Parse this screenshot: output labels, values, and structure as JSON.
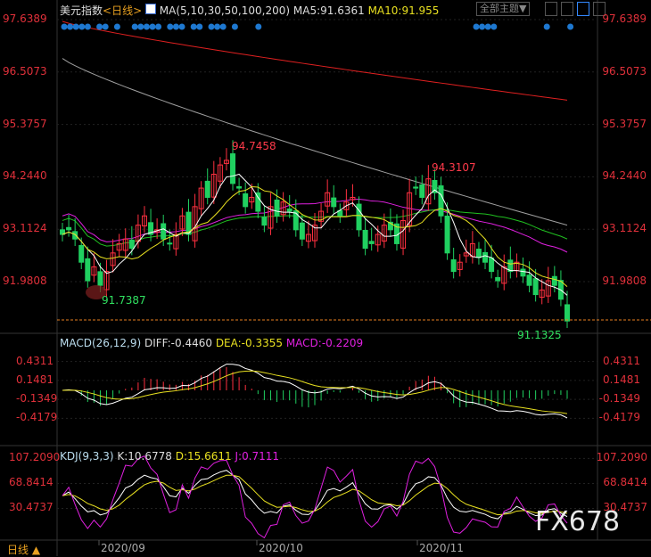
{
  "header": {
    "symbol": "美元指数",
    "period": "<日线>",
    "ma_label": "MA(5,10,30,50,100,200)",
    "ma5": "MA5:91.6361",
    "ma10": "MA10:91.955",
    "theme_button": "全部主题▼"
  },
  "macd": {
    "label": "MACD(26,12,9)",
    "diff": "DIFF:-0.4460",
    "dea": "DEA:-0.3355",
    "macd": "MACD:-0.2209",
    "ticks": [
      "0.4311",
      "0.1481",
      "-0.1349",
      "-0.4179"
    ]
  },
  "kdj": {
    "label": "KDJ(9,3,3)",
    "k": "K:10.6778",
    "d": "D:15.6611",
    "j": "J:0.7111",
    "ticks": [
      "107.2090",
      "68.8414",
      "30.4737"
    ]
  },
  "footer": {
    "period": "日线",
    "dates": [
      "2020/09",
      "2020/10",
      "2020/11"
    ]
  },
  "watermark": "FX678",
  "colors": {
    "up": "#ff3040",
    "down": "#20d060",
    "ma5": "#ffffff",
    "ma10": "#e8e020",
    "ma30": "#e020e0",
    "ma50": "#20c020",
    "ma100": "#a0a0a0",
    "ma200": "#e02020"
  },
  "chart_data": {
    "type": "candlestick",
    "y_ticks": [
      "97.6389",
      "96.5073",
      "95.3757",
      "94.2440",
      "93.1124",
      "91.9808"
    ],
    "ylim": [
      91.13,
      97.6389
    ],
    "annotations": {
      "high1": "94.7458",
      "high2": "94.3107",
      "low1": "91.7387",
      "low2": "91.1325"
    },
    "closes": [
      93.0,
      93.1,
      92.9,
      92.4,
      92.0,
      92.3,
      91.9,
      92.2,
      92.6,
      92.8,
      92.9,
      92.7,
      93.2,
      93.4,
      93.0,
      93.1,
      92.9,
      92.8,
      93.0,
      93.4,
      93.0,
      93.6,
      94.0,
      93.8,
      94.3,
      94.5,
      94.6,
      94.1,
      94.0,
      93.6,
      93.8,
      93.5,
      93.2,
      93.6,
      93.4,
      93.7,
      93.5,
      93.1,
      92.9,
      93.0,
      93.2,
      93.5,
      93.9,
      93.6,
      93.4,
      93.7,
      93.8,
      93.1,
      92.7,
      92.8,
      93.0,
      93.2,
      93.1,
      92.8,
      93.3,
      93.9,
      94.0,
      93.8,
      94.2,
      93.9,
      93.4,
      92.6,
      92.2,
      92.4,
      92.6,
      92.8,
      92.5,
      92.4,
      92.2,
      92.0,
      92.3,
      92.2,
      92.4,
      92.1,
      91.9,
      91.7,
      91.8,
      92.0,
      91.9,
      91.6,
      91.13
    ],
    "ma100_range": [
      96.8,
      93.2
    ],
    "ma200_range": [
      97.6,
      95.9
    ]
  }
}
